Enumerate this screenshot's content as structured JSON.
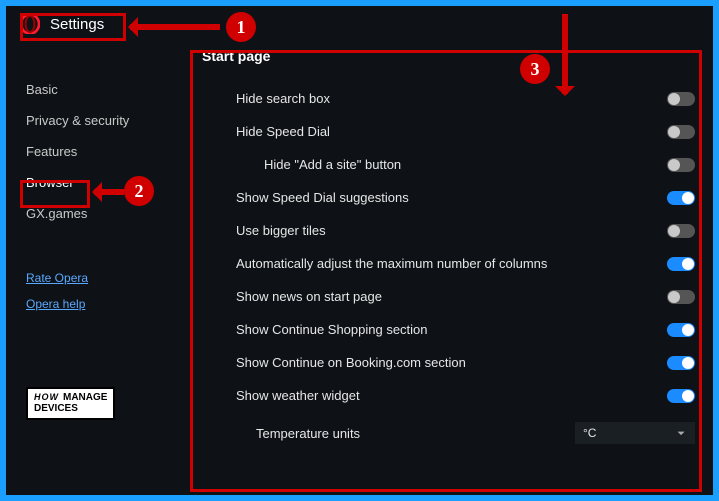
{
  "header": {
    "title": "Settings"
  },
  "sidebar": {
    "items": [
      {
        "label": "Basic"
      },
      {
        "label": "Privacy & security"
      },
      {
        "label": "Features"
      },
      {
        "label": "Browser",
        "active": true
      },
      {
        "label": "GX.games"
      }
    ],
    "links": [
      {
        "label": "Rate Opera"
      },
      {
        "label": "Opera help"
      }
    ],
    "badge": {
      "line1_a": "HOW",
      "line1_b": "MANAGE",
      "line2": "DEVICES"
    }
  },
  "main": {
    "section_title": "Start page",
    "rows": [
      {
        "label": "Hide search box",
        "on": false,
        "indent": 1
      },
      {
        "label": "Hide Speed Dial",
        "on": false,
        "indent": 1
      },
      {
        "label": "Hide \"Add a site\" button",
        "on": false,
        "indent": 2
      },
      {
        "label": "Show Speed Dial suggestions",
        "on": true,
        "indent": 1
      },
      {
        "label": "Use bigger tiles",
        "on": false,
        "indent": 1
      },
      {
        "label": "Automatically adjust the maximum number of columns",
        "on": true,
        "indent": 1
      },
      {
        "label": "Show news on start page",
        "on": false,
        "indent": 1
      },
      {
        "label": "Show Continue Shopping section",
        "on": true,
        "indent": 1
      },
      {
        "label": "Show Continue on Booking.com section",
        "on": true,
        "indent": 1
      },
      {
        "label": "Show weather widget",
        "on": true,
        "indent": 1
      }
    ],
    "temperature_label": "Temperature units",
    "temperature_value": "°C"
  },
  "annotations": {
    "n1": "1",
    "n2": "2",
    "n3": "3"
  }
}
